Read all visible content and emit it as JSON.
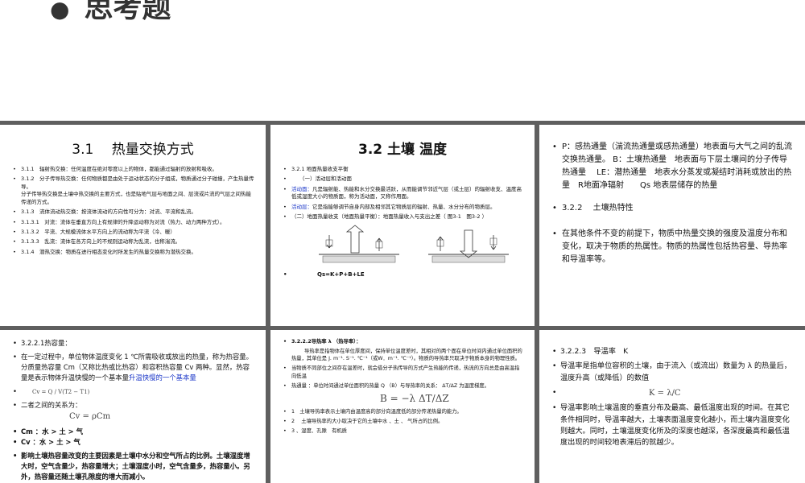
{
  "header": {
    "title": "思考题"
  },
  "slide1": {
    "title": "3.1　 热量交换方式",
    "items": [
      "3.1.1　辐射热交换：任何温度在绝对零度以上的物体，都能通过辐射的放射和吸收。",
      "3.1.2　分子传导热交换：任何物质都是由处于运动状态的分子组成，物质通过分子碰撞，产生热量传导。",
      "分子传导热交换是土壤中热交换的主要方式，也是贴地气层与地面之间、层流或片流的气层之间热能传递的方式。",
      "3.1.3　流体流动热交换：按流体流动的方向性可分为：对流、平流和乱流。",
      "3.1.3.1　对流：流体在垂直方向上有规律的升降运动称为对流（热力、动力两种方式）。",
      "3.1.3.2　平流、大规模流体水平方向上的流动称为平流（冷、暖）",
      "3.1.3.3　乱流：流体在各方向上的不规则运动称为乱流，也称湍流。",
      "3.1.4　潜热交换：物质在进行相态变化时所发生的热量交换称为潜热交换。"
    ]
  },
  "slide2": {
    "title": "3.2  土壤 温度",
    "items": [
      "3.2.1  地面热量收支平衡",
      "（一）活动层和活动面",
      "活动面：",
      "凡是辐射能、热能和水分交换最活跃，从而能调节邻近气层（或土层）的辐射收支、温度高低或湿度大小的物质面，称为活动面，又称作用面。",
      "活动层：",
      "它是指能够调节自身内部及相邻其它物质层的辐射、热量、水分分布的物质层。",
      "（二）地面热量收支（地面热量平衡）：地面热量收入与支出之差（ 图3-1　图3-2 ）",
      "Qs=K+P+B+LE"
    ]
  },
  "slide3": {
    "items": [
      "P：感热通量（湍流热通量或感热通量）地表面与大气之间的乱流交换热通量。 B：土壤热通量　地表面与下层土壤间的分子传导热通量　 LE：潜热通量　地表水分蒸发或凝结时消耗或放出的热量　R地面净辐射　　Qs 地表层储存的热量",
      "3.2.2　 土壤热特性",
      "在其他条件不变的前提下，物质中热量交换的强度及温度分布和变化，取决于物质的热属性。物质的热属性包括热容量、导热率和导温率等。"
    ]
  },
  "slide4": {
    "items": [
      "3.2.2.1热容量：",
      "在一定过程中，单位物体温度变化 1 ℃所需吸收或放出的热量，称为热容量。分质量热容量 Cm（又称比热或比热容）和容积热容量 Cv 两种。显然，热容量是表示物体升温快慢的一个基本量",
      "二者之间的关系为：",
      "Cm ：水 > 土 > 气",
      "Cv ：水 > 土 > 气",
      "影响土壤热容量改变的主要因素是土壤中水分和空气所占的比例。土壤湿度增大时，空气含量少，热容量增大；土壤湿度小时，空气含量多，热容量小。另外，热容量还随土壤孔隙度的增大而减小。"
    ],
    "highlight": "升温快慢的一个基本量",
    "formula1": "Cv = Q / V(T2 − T1)",
    "formula2": "Cv = ρCm"
  },
  "slide5": {
    "items": [
      "3.2.2.2导热率 λ （热导率）：",
      "导热率是指物体在单位厚度间，保持单位温度差时，其相对的两个面在单位时间内通过单位面积的热量，其单位是 J. m⁻¹. S⁻¹. ℃⁻¹（或W．m⁻¹. ℃⁻¹）。物质的导热率只取决于物质本身的物理性质。",
      "当物质不同部位之间存在温差时，就会借分子热传导的方式产生热能的传递，热流的方向总是由高温指向低温",
      "热通量 ：单位时间通过单位面积的热量 Q （B）与导热率的关系： ΔT/ΔZ 为温度梯度。",
      "1　土壤导热率表示土壤内由温度高的部分向温度低的部分传递热量的能力。",
      "2　 土壤导热率的大小取决于它的土壤中水 、土 、 气所占的比例。",
      "3 、湿度、孔隙　有机质"
    ],
    "formula": "B = −λ ΔT/ΔZ"
  },
  "slide6": {
    "items": [
      "3.2.2.3　导温率　K",
      "导温率是指单位容积的土壤，由于流入（或流出）数量为 λ 的热量后，温度升高（或降低）的数值",
      "导温率影响土壤温度的垂直分布及最高、最低温度出现的时间。在其它条件相同时，导温率越大，土壤表面温度变化越小，而土壤内温度变化则越大。同时，土壤温度变化所及的深度也越深，各深度最高和最低温度出现的时间较地表滞后的就越少。"
    ],
    "lambda": "λ",
    "formula": "K = λ/C"
  },
  "colors": {
    "background": "#5f5f5f",
    "blue": "#1a36c8",
    "red": "#d40000"
  }
}
